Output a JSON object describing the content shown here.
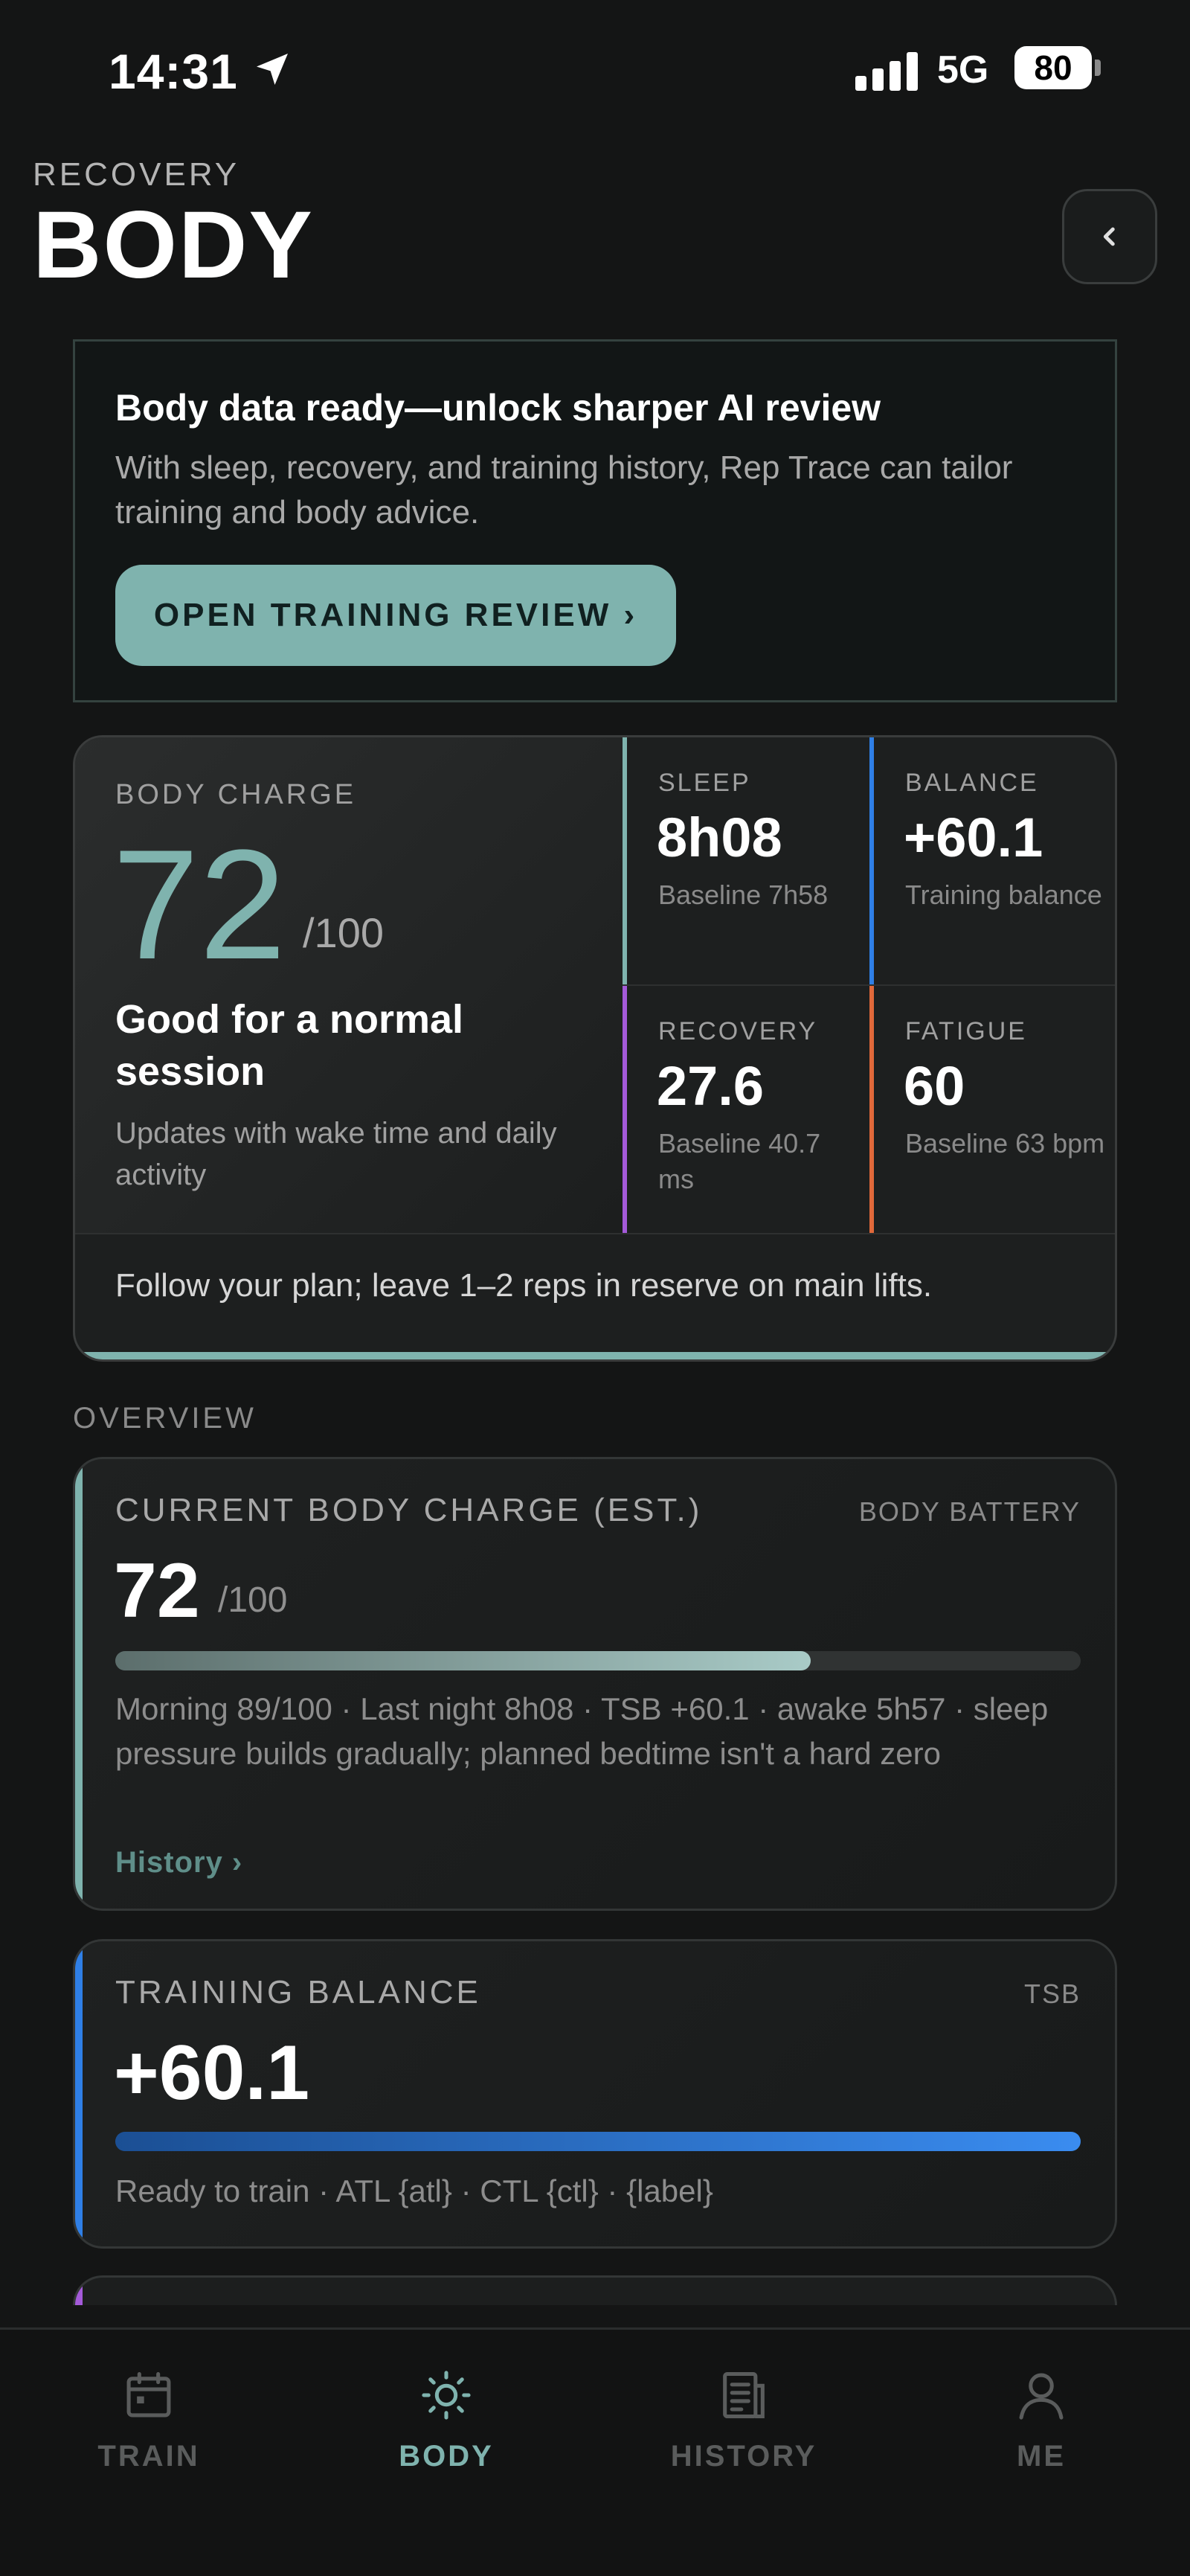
{
  "status_bar": {
    "time": "14:31",
    "network": "5G",
    "battery": "80"
  },
  "header": {
    "eyebrow": "RECOVERY",
    "title": "BODY",
    "back_icon": "chevron-left-icon"
  },
  "promo": {
    "title": "Body data ready—unlock sharper AI review",
    "body": "With sleep, recovery, and training history, Rep Trace can tailor training and body advice.",
    "button": "OPEN TRAINING REVIEW ›"
  },
  "body_charge": {
    "eyebrow": "BODY CHARGE",
    "value": "72",
    "of": "/100",
    "headline": "Good for a normal session",
    "sub": "Updates with wake time and daily activity",
    "advice": "Follow your plan; leave 1–2 reps in reserve on main lifts.",
    "accent_color": "#7fb3ae",
    "metrics": [
      {
        "label": "SLEEP",
        "value": "8h08",
        "sub": "Baseline 7h58",
        "color": "#7fb3ae"
      },
      {
        "label": "BALANCE",
        "value": "+60.1",
        "sub": "Training balance",
        "color": "#2f7fe6"
      },
      {
        "label": "RECOVERY",
        "value": "27.6",
        "sub": "Baseline 40.7 ms",
        "color": "#a45ad9"
      },
      {
        "label": "FATIGUE",
        "value": "60",
        "sub": "Baseline 63 bpm",
        "color": "#e0683a"
      }
    ]
  },
  "overview": {
    "eyebrow": "OVERVIEW",
    "cards": [
      {
        "label": "CURRENT BODY CHARGE (EST.)",
        "tag": "BODY BATTERY",
        "value": "72",
        "of": "/100",
        "progress": 0.72,
        "description": "Morning 89/100 · Last night 8h08 · TSB +60.1 · awake 5h57 · sleep pressure builds gradually; planned bedtime isn't a hard zero",
        "link": "History ›",
        "color": "#7fb3ae"
      },
      {
        "label": "TRAINING BALANCE",
        "tag": "TSB",
        "value": "+60.1",
        "progress": 1.0,
        "description": "Ready to train · ATL {atl} · CTL {ctl} · {label}",
        "color": "#2f7fe6"
      }
    ]
  },
  "tabbar": {
    "tabs": [
      {
        "label": "TRAIN",
        "icon": "calendar-icon",
        "active": false
      },
      {
        "label": "BODY",
        "icon": "sun-icon",
        "active": true
      },
      {
        "label": "HISTORY",
        "icon": "document-icon",
        "active": false
      },
      {
        "label": "ME",
        "icon": "person-icon",
        "active": false
      }
    ],
    "active_color": "#7fb3ae",
    "inactive_color": "#5a5c5c"
  }
}
